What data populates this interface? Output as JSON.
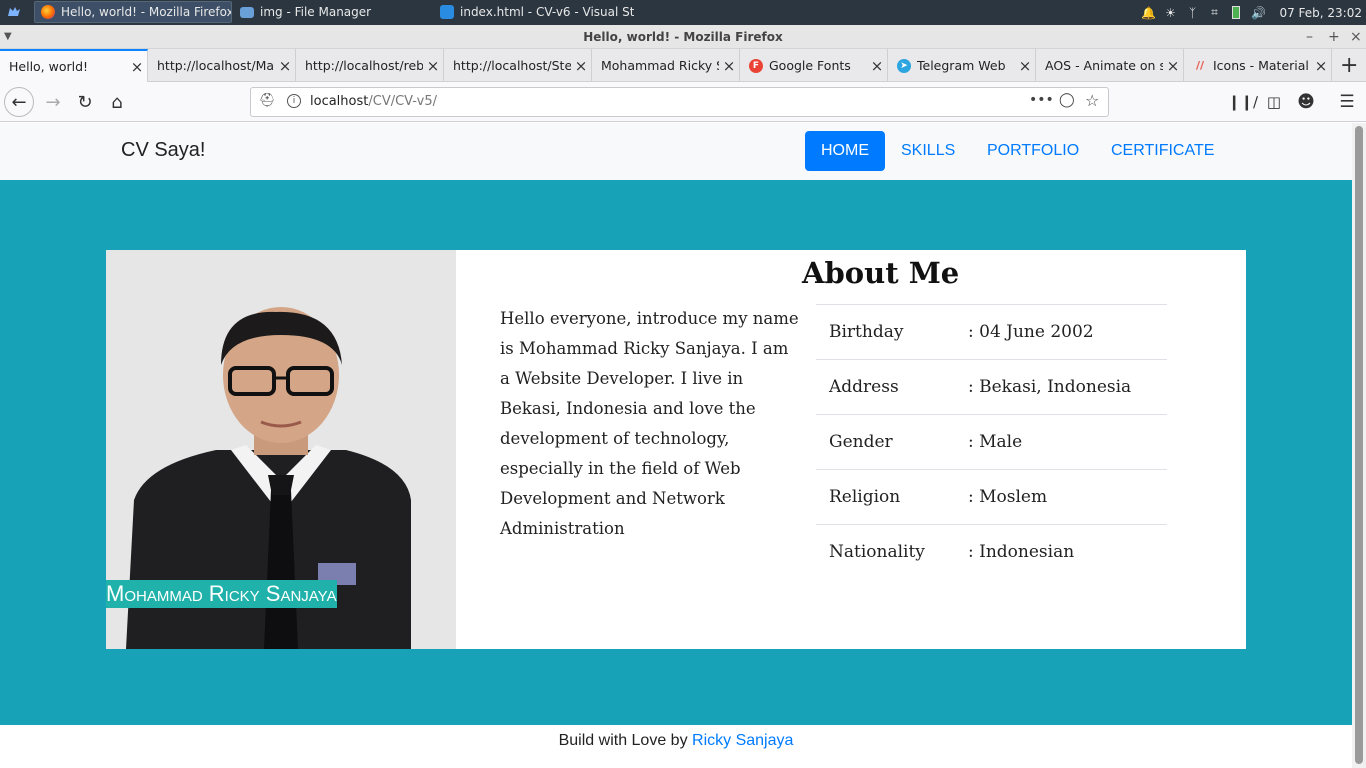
{
  "taskbar": {
    "tasks": [
      {
        "label": "Hello, world! - Mozilla Firefox",
        "icon": "firefox-icon",
        "active": true
      },
      {
        "label": "img - File Manager",
        "icon": "folder-icon",
        "active": false
      },
      {
        "label": "index.html - CV-v6 - Visual St...",
        "icon": "vscode-icon",
        "active": false
      }
    ],
    "clock": "07 Feb, 23:02"
  },
  "window": {
    "title": "Hello, world! - Mozilla Firefox"
  },
  "tabs": [
    {
      "label": "Hello, world!",
      "favicon": "none"
    },
    {
      "label": "http://localhost/Ma",
      "favicon": "none"
    },
    {
      "label": "http://localhost/reb",
      "favicon": "none"
    },
    {
      "label": "http://localhost/Ste",
      "favicon": "none"
    },
    {
      "label": "Mohammad Ricky S",
      "favicon": "none"
    },
    {
      "label": "Google Fonts",
      "favicon": "google-fonts-icon"
    },
    {
      "label": "Telegram Web",
      "favicon": "telegram-icon"
    },
    {
      "label": "AOS - Animate on sc",
      "favicon": "none"
    },
    {
      "label": "Icons - Material",
      "favicon": "material-icon"
    }
  ],
  "url": {
    "host": "localhost",
    "path": "/CV/CV-v5/"
  },
  "site": {
    "brand": "CV Saya!",
    "menu": [
      "HOME",
      "SKILLS",
      "PORTFOLIO",
      "CERTIFICATE"
    ],
    "active_menu": "HOME",
    "photo_caption": "Mohammad Ricky Sanjaya",
    "bio": "Hello everyone, introduce my name is Mohammad Ricky Sanjaya. I am a Website Developer. I live in Bekasi, Indonesia and love the development of technology, especially in the field of Web Development and Network Administration",
    "about_title": "About Me",
    "info": [
      {
        "key": "Birthday",
        "value": ": 04 June 2002"
      },
      {
        "key": "Address",
        "value": ": Bekasi, Indonesia"
      },
      {
        "key": "Gender",
        "value": ": Male"
      },
      {
        "key": "Religion",
        "value": ": Moslem"
      },
      {
        "key": "Nationality",
        "value": ": Indonesian"
      }
    ],
    "footer_text": "Build with Love by ",
    "footer_link": "Ricky Sanjaya"
  },
  "colors": {
    "hero": "#17a2b8",
    "accent": "#007bff",
    "caption_bg": "#20b2aa"
  }
}
